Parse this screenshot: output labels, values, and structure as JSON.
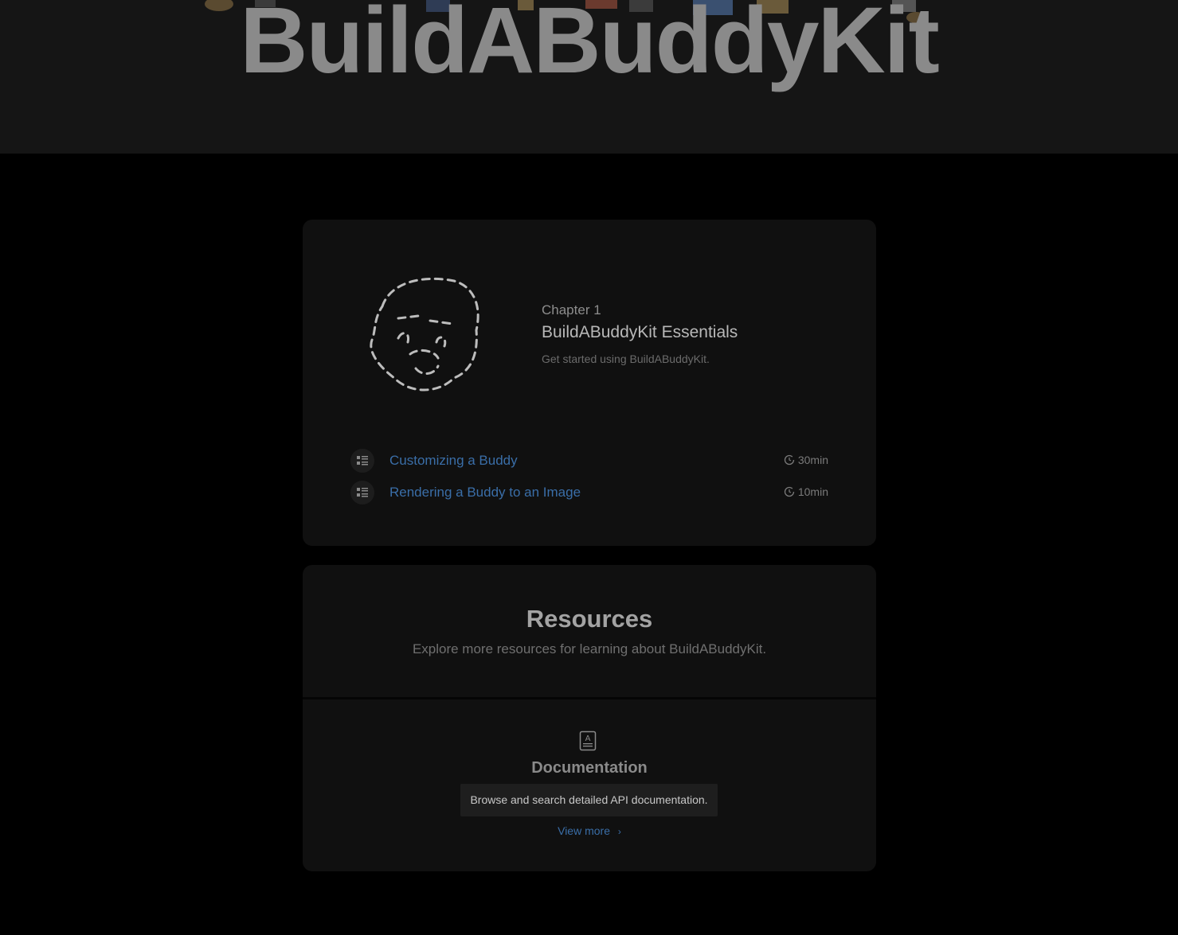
{
  "hero": {
    "title": "BuildABuddyKit"
  },
  "chapter": {
    "eyebrow": "Chapter 1",
    "title": "BuildABuddyKit Essentials",
    "description": "Get started using BuildABuddyKit.",
    "tutorials": [
      {
        "title": "Customizing a Buddy",
        "duration": "30min",
        "icon": "list-icon"
      },
      {
        "title": "Rendering a Buddy to an Image",
        "duration": "10min",
        "icon": "list-icon"
      }
    ]
  },
  "resources": {
    "title": "Resources",
    "subtitle": "Explore more resources for learning about BuildABuddyKit.",
    "documentation": {
      "icon": "documentation-icon",
      "title": "Documentation",
      "tooltip": "Browse and search detailed API documentation.",
      "link": "View more"
    }
  },
  "colors": {
    "link": "#3a6ea8",
    "background": "#000000",
    "card": "#101010"
  }
}
